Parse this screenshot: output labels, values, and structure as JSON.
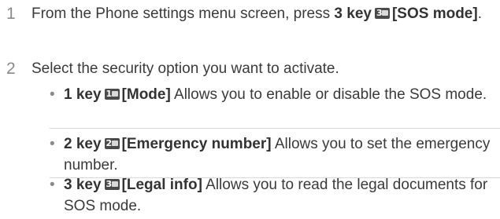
{
  "steps": [
    {
      "number": "1",
      "text_before": "From the Phone settings menu screen, press ",
      "key_label": "3 key",
      "key_digit": "3",
      "bold_after": "[SOS mode]",
      "text_after": "."
    },
    {
      "number": "2",
      "text": "Select the security option you want to activate."
    }
  ],
  "bullets": [
    {
      "dot": "•",
      "key_label": "1 key",
      "key_digit": "1",
      "title": "[Mode]",
      "description": " Allows you to enable or disable the SOS mode."
    },
    {
      "dot": "•",
      "key_label": "2 key",
      "key_digit": "2",
      "title": "[Emergency number]",
      "description": " Allows you to set the emergency number."
    },
    {
      "dot": "•",
      "key_label": "3 key",
      "key_digit": "3",
      "title": "[Legal info]",
      "description": " Allows you to read the legal documents for SOS mode."
    }
  ]
}
